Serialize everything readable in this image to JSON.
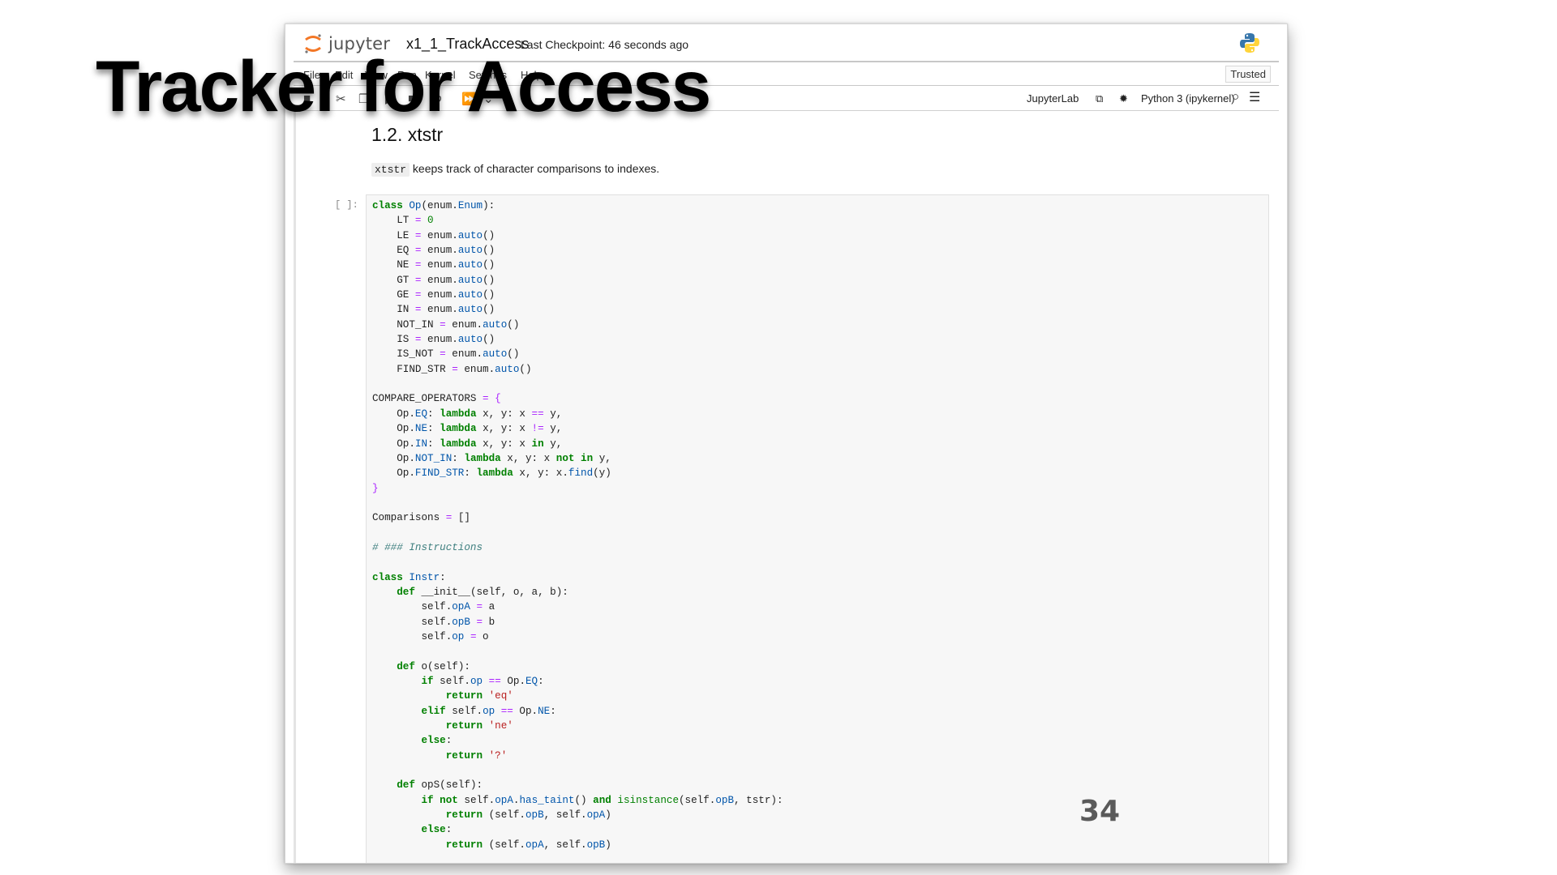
{
  "slide": {
    "title": "Tracker for Access",
    "page_number": "34"
  },
  "notebook": {
    "app_name": "jupyter",
    "notebook_name": "x1_1_TrackAccess",
    "checkpoint": "Last Checkpoint: 46 seconds ago",
    "menu": [
      "File",
      "Edit",
      "View",
      "Run",
      "Kernel",
      "Settings",
      "Help"
    ],
    "trusted": "Trusted",
    "toolbar": {
      "jupyterlab": "JupyterLab",
      "kernel": "Python 3 (ipykernel)"
    },
    "heading": "1.2. xtstr",
    "paragraph": {
      "code": "xtstr",
      "text": "keeps track of character comparisons to indexes."
    },
    "cell_prompt": "[ ]:"
  },
  "code_lines": [
    "class Op(enum.Enum):",
    "    LT = 0",
    "    LE = enum.auto()",
    "    EQ = enum.auto()",
    "    NE = enum.auto()",
    "    GT = enum.auto()",
    "    GE = enum.auto()",
    "    IN = enum.auto()",
    "    NOT_IN = enum.auto()",
    "    IS = enum.auto()",
    "    IS_NOT = enum.auto()",
    "    FIND_STR = enum.auto()",
    "",
    "COMPARE_OPERATORS = {",
    "    Op.EQ: lambda x, y: x == y,",
    "    Op.NE: lambda x, y: x != y,",
    "    Op.IN: lambda x, y: x in y,",
    "    Op.NOT_IN: lambda x, y: x not in y,",
    "    Op.FIND_STR: lambda x, y: x.find(y)",
    "}",
    "",
    "Comparisons = []",
    "",
    "# ### Instructions",
    "",
    "class Instr:",
    "    def __init__(self, o, a, b):",
    "        self.opA = a",
    "        self.opB = b",
    "        self.op = o",
    "",
    "    def o(self):",
    "        if self.op == Op.EQ:",
    "            return 'eq'",
    "        elif self.op == Op.NE:",
    "            return 'ne'",
    "        else:",
    "            return '?'",
    "",
    "    def opS(self):",
    "        if not self.opA.has_taint() and isinstance(self.opB, tstr):",
    "            return (self.opB, self.opA)",
    "        else:",
    "            return (self.opA, self.opB)"
  ]
}
